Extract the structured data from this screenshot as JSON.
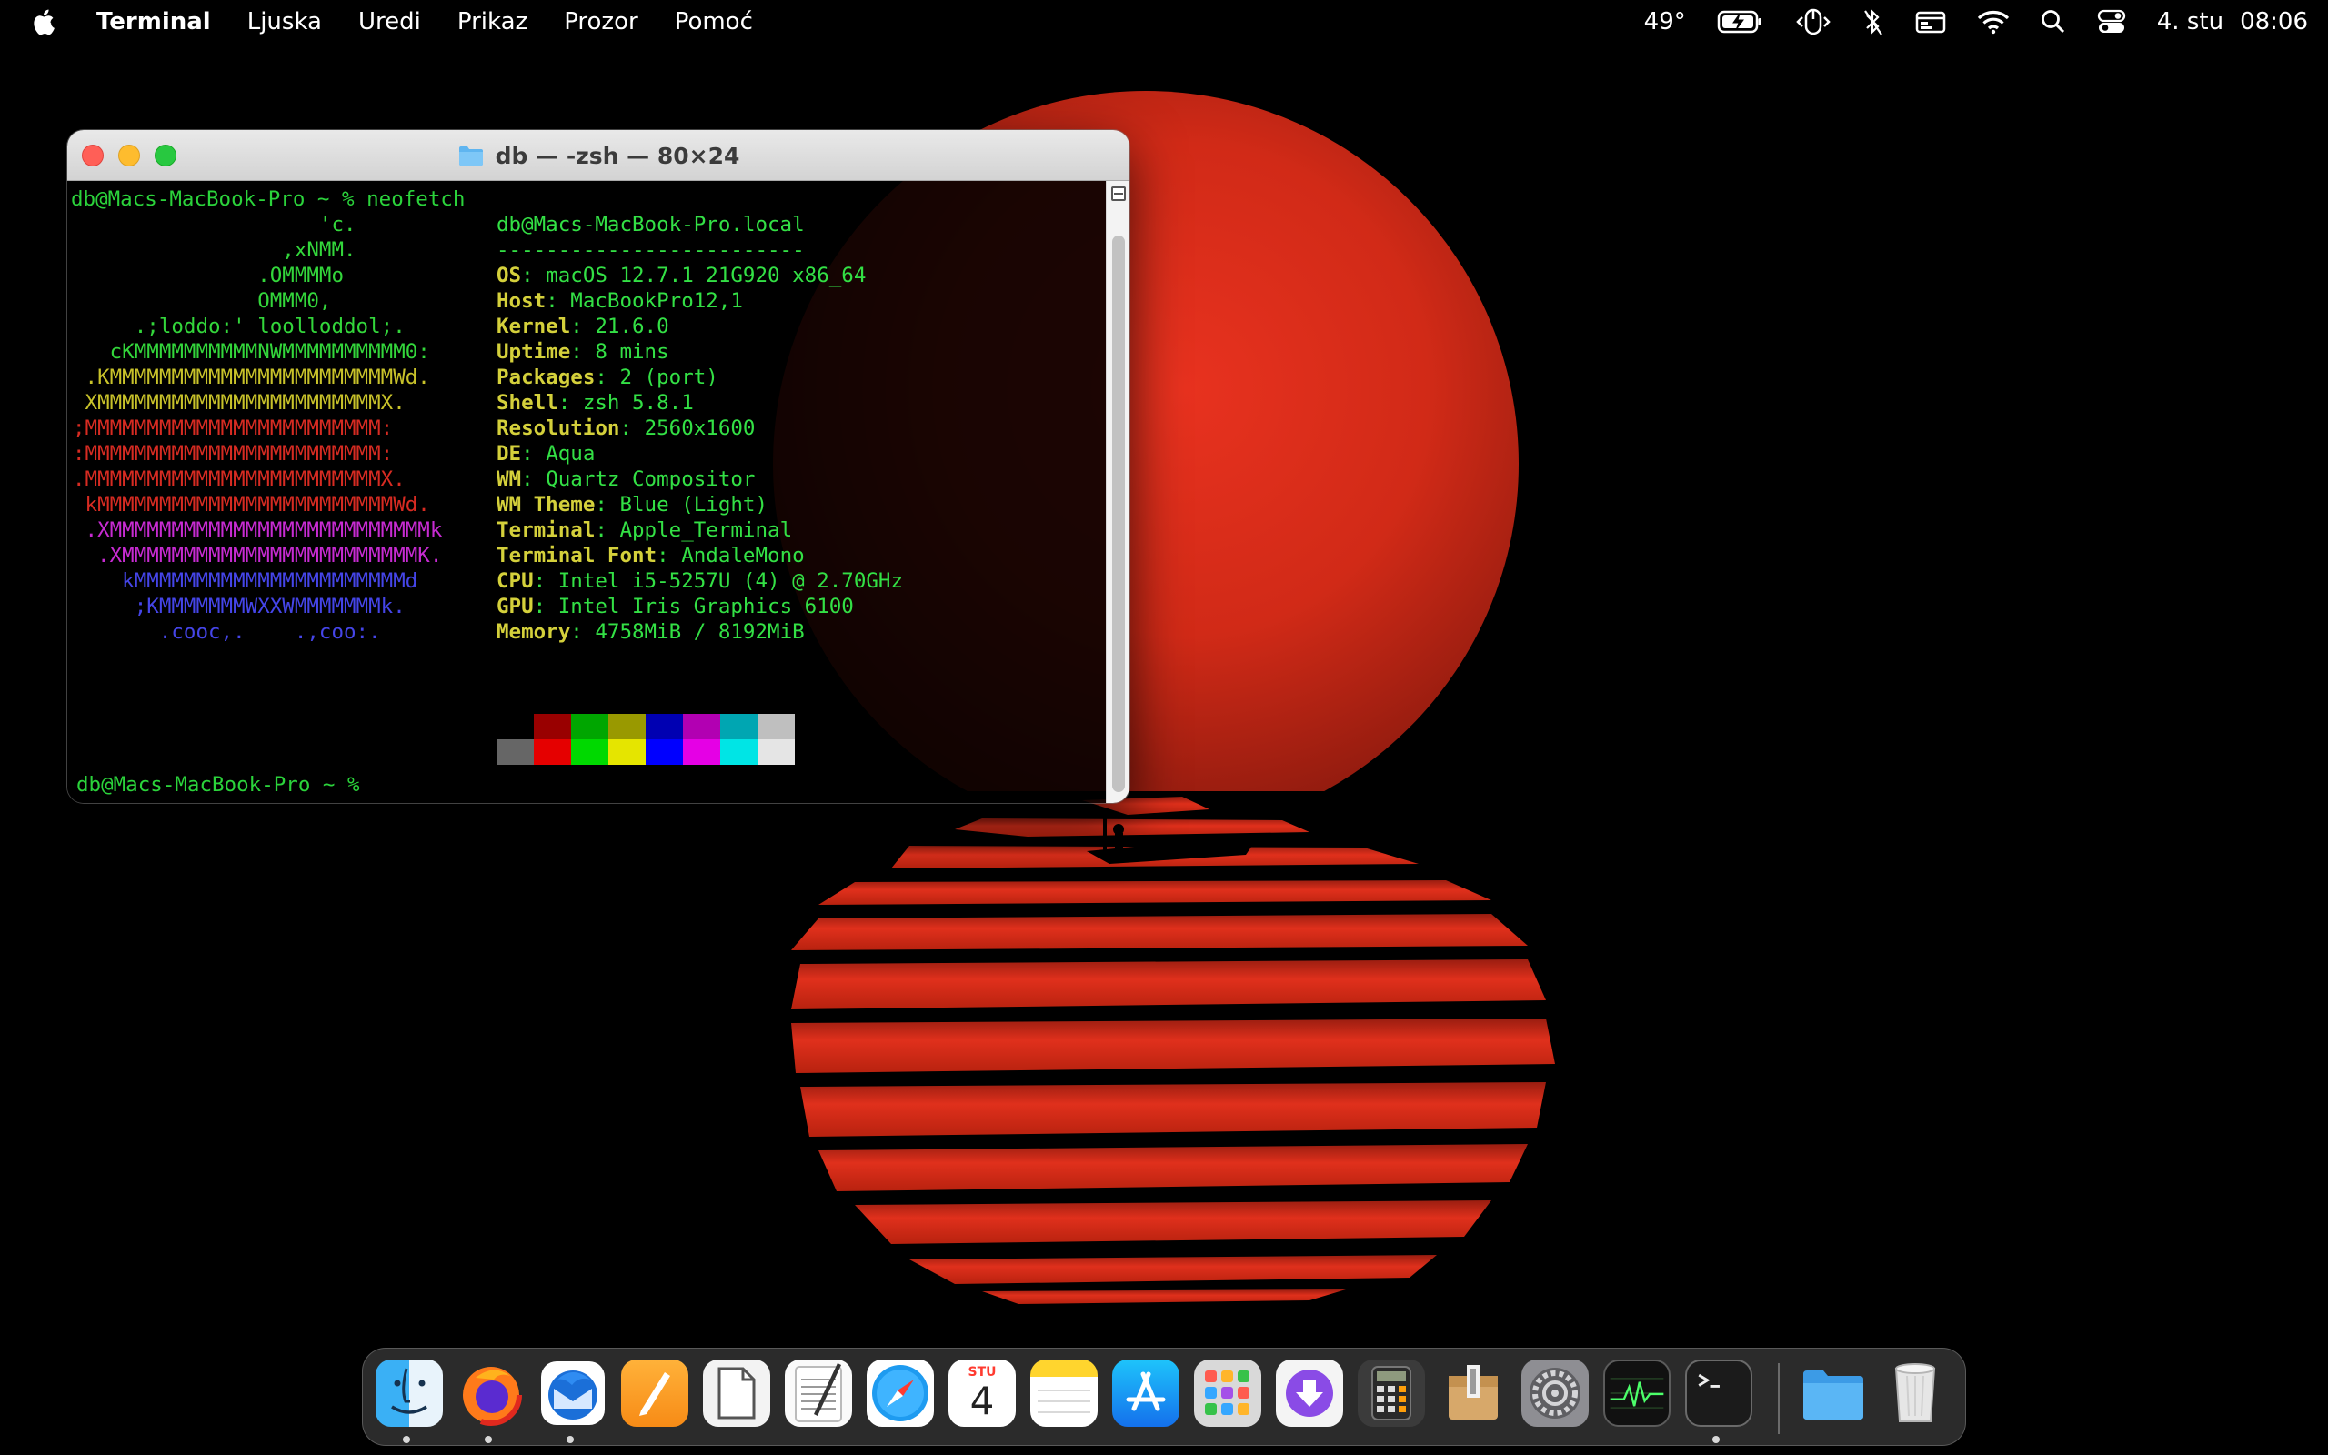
{
  "menubar": {
    "app_name": "Terminal",
    "items": [
      "Ljuska",
      "Uredi",
      "Prikaz",
      "Prozor",
      "Pomoć"
    ],
    "temperature": "49°",
    "date": "4. stu",
    "time": "08:06"
  },
  "window": {
    "title": "db — -zsh — 80×24"
  },
  "terminal": {
    "prompt": "db@Macs-MacBook-Pro ~ %",
    "command": "neofetch",
    "user_host": "db@Macs-MacBook-Pro.local",
    "separator": "-------------------------",
    "logo_lines": [
      {
        "text": "                    'c.",
        "color": "#33d63b"
      },
      {
        "text": "                 ,xNMM.",
        "color": "#33d63b"
      },
      {
        "text": "               .OMMMMo",
        "color": "#33d63b"
      },
      {
        "text": "               OMMM0,",
        "color": "#33d63b"
      },
      {
        "text": "     .;loddo:' loolloddol;.",
        "color": "#33d63b"
      },
      {
        "text": "   cKMMMMMMMMMMNWMMMMMMMMMM0:",
        "color": "#33d63b"
      },
      {
        "text": " .KMMMMMMMMMMMMMMMMMMMMMMMWd.",
        "color": "#c8c22a"
      },
      {
        "text": " XMMMMMMMMMMMMMMMMMMMMMMMX.",
        "color": "#c8c22a"
      },
      {
        "text": ";MMMMMMMMMMMMMMMMMMMMMMMM:",
        "color": "#d72b22"
      },
      {
        "text": ":MMMMMMMMMMMMMMMMMMMMMMMM:",
        "color": "#d72b22"
      },
      {
        "text": ".MMMMMMMMMMMMMMMMMMMMMMMMX.",
        "color": "#d72b22"
      },
      {
        "text": " kMMMMMMMMMMMMMMMMMMMMMMMMWd.",
        "color": "#d72b22"
      },
      {
        "text": " .XMMMMMMMMMMMMMMMMMMMMMMMMMMk",
        "color": "#c72bd2"
      },
      {
        "text": "  .XMMMMMMMMMMMMMMMMMMMMMMMMK.",
        "color": "#c72bd2"
      },
      {
        "text": "    kMMMMMMMMMMMMMMMMMMMMMMd",
        "color": "#4545e8"
      },
      {
        "text": "     ;KMMMMMMMWXXWMMMMMMMk.",
        "color": "#4545e8"
      },
      {
        "text": "       .cooc,.    .,coo:.",
        "color": "#4545e8"
      }
    ],
    "info": [
      {
        "label": "OS",
        "value": "macOS 12.7.1 21G920 x86_64"
      },
      {
        "label": "Host",
        "value": "MacBookPro12,1"
      },
      {
        "label": "Kernel",
        "value": "21.6.0"
      },
      {
        "label": "Uptime",
        "value": "8 mins"
      },
      {
        "label": "Packages",
        "value": "2 (port)"
      },
      {
        "label": "Shell",
        "value": "zsh 5.8.1"
      },
      {
        "label": "Resolution",
        "value": "2560x1600"
      },
      {
        "label": "DE",
        "value": "Aqua"
      },
      {
        "label": "WM",
        "value": "Quartz Compositor"
      },
      {
        "label": "WM Theme",
        "value": "Blue (Light)"
      },
      {
        "label": "Terminal",
        "value": "Apple_Terminal"
      },
      {
        "label": "Terminal Font",
        "value": "AndaleMono"
      },
      {
        "label": "CPU",
        "value": "Intel i5-5257U (4) @ 2.70GHz"
      },
      {
        "label": "GPU",
        "value": "Intel Iris Graphics 6100"
      },
      {
        "label": "Memory",
        "value": "4758MiB / 8192MiB"
      }
    ],
    "palette_top": [
      "#000000",
      "#990000",
      "#00a600",
      "#999900",
      "#0000b2",
      "#b200b2",
      "#00a6b2",
      "#bfbfbf"
    ],
    "palette_bottom": [
      "#666666",
      "#e50000",
      "#00d900",
      "#e5e500",
      "#0000ff",
      "#e500e5",
      "#00e5e5",
      "#e5e5e5"
    ]
  },
  "dock": {
    "calendar_month": "STU",
    "calendar_day": "4",
    "apps": [
      {
        "name": "finder",
        "running": true
      },
      {
        "name": "firefox",
        "running": true
      },
      {
        "name": "thunderbird",
        "running": true
      },
      {
        "name": "pages",
        "running": false
      },
      {
        "name": "preview",
        "running": false
      },
      {
        "name": "textedit",
        "running": false
      },
      {
        "name": "safari",
        "running": false
      },
      {
        "name": "calendar",
        "running": false
      },
      {
        "name": "notes",
        "running": false
      },
      {
        "name": "app-store",
        "running": false
      },
      {
        "name": "launchpad",
        "running": false
      },
      {
        "name": "downloader",
        "running": false
      },
      {
        "name": "calculator",
        "running": false
      },
      {
        "name": "archive-utility",
        "running": false
      },
      {
        "name": "system-preferences",
        "running": false
      },
      {
        "name": "activity-monitor",
        "running": false
      },
      {
        "name": "terminal",
        "running": true
      },
      {
        "name": "downloads-folder",
        "running": false
      },
      {
        "name": "trash",
        "running": false
      }
    ]
  }
}
